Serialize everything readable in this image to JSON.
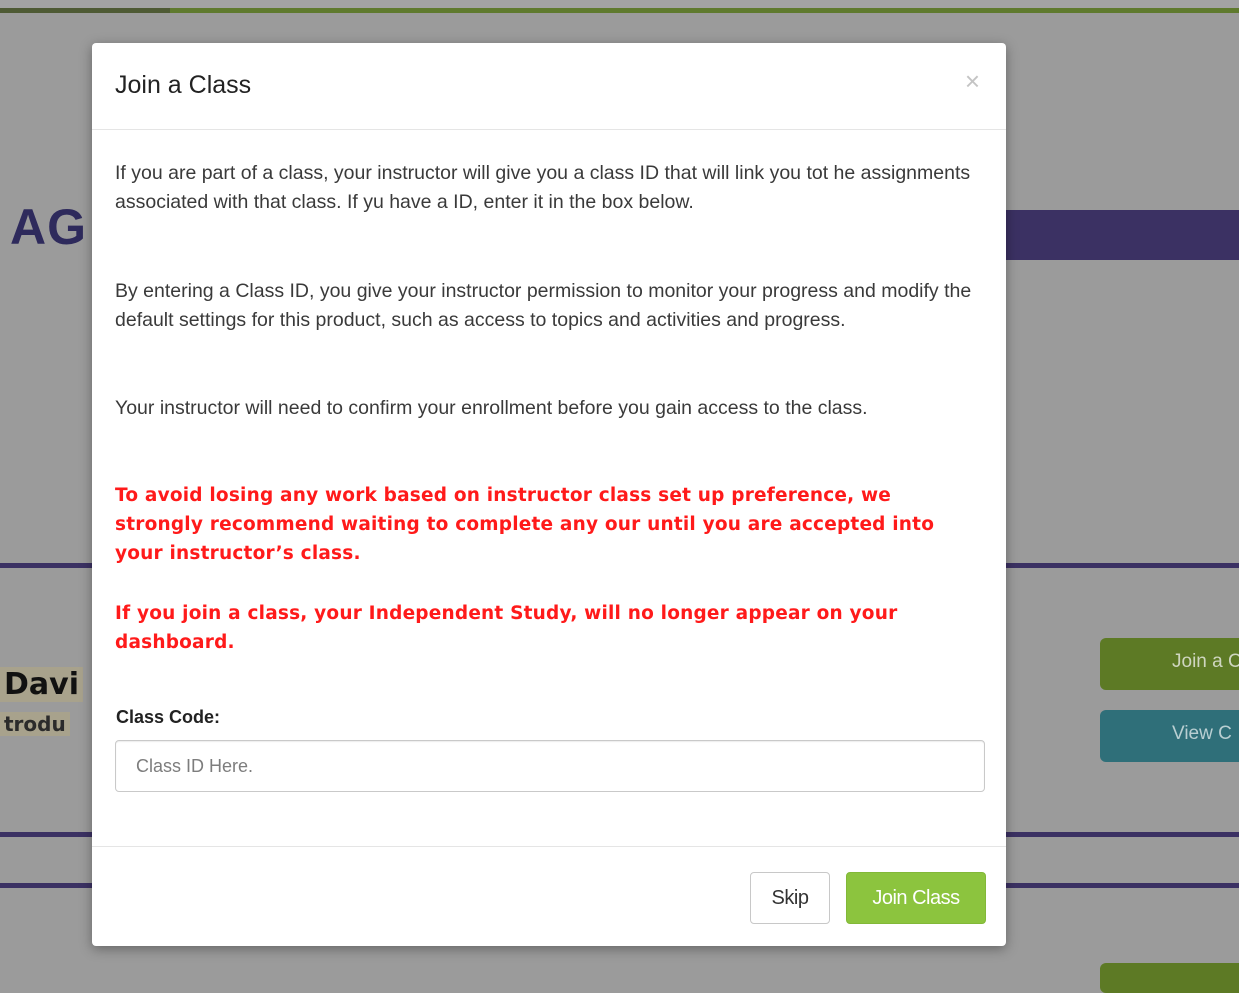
{
  "background": {
    "logo_fragment": "AG",
    "name_fragment": "Davi",
    "course_fragment": "trodu",
    "join_button_fragment": "Join a C",
    "view_button_fragment": "View C"
  },
  "modal": {
    "title": "Join a Class",
    "close_icon": "×",
    "paragraphs": [
      "If you are part of a class, your instructor will give you a class ID that will  link  you tot he assignments associated with that class. If yu have a ID, enter it in the box below.",
      "By entering a Class ID, you give your instructor permission to monitor your progress and modify the default settings for this product, such as access to topics and activities and progress.",
      "Your instructor will need to confirm your enrollment before you gain access to the class."
    ],
    "warnings": [
      "To avoid losing any work based on instructor class set up preference, we strongly recommend waiting to complete any our until you are accepted into your instructor’s class.",
      "If you join a class, your Independent Study, will no longer appear on your dashboard."
    ],
    "class_code_label": "Class Code:",
    "class_code_placeholder": "Class ID Here.",
    "class_code_value": "",
    "skip_label": "Skip",
    "join_label": "Join Class"
  },
  "colors": {
    "backdrop": "#9b9b9b",
    "banner_purple": "#3b3163",
    "warning_red": "#ff1a1a",
    "join_green": "#8cc43e"
  }
}
